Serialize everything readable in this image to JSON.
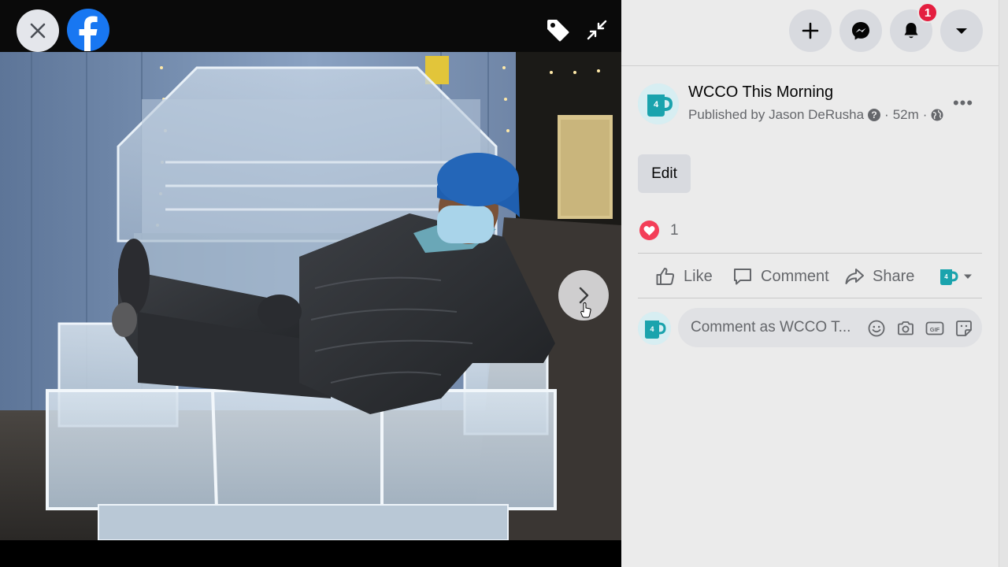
{
  "viewer": {
    "icons": {
      "close": "close-icon",
      "logo": "facebook-logo",
      "tag": "tag-icon",
      "collapse": "collapse-icon",
      "next": "chevron-right-icon"
    }
  },
  "header": {
    "notification_count": "1",
    "icons": [
      "plus-icon",
      "messenger-icon",
      "bell-icon",
      "caret-down-icon"
    ]
  },
  "post": {
    "page_name": "WCCO This Morning",
    "published_by": "Published by Jason DeRusha",
    "time": "52m",
    "separator": "·",
    "more": "•••",
    "edit_label": "Edit",
    "reaction_count": "1"
  },
  "actions": {
    "like": "Like",
    "comment": "Comment",
    "share": "Share"
  },
  "comment_box": {
    "placeholder": "Comment as WCCO T..."
  },
  "colors": {
    "facebook_blue": "#1877f2",
    "badge_red": "#e41e3f",
    "panel_bg": "#ebebeb",
    "text_secondary": "#65676b",
    "love_red": "#f33e58",
    "mug_teal": "#1aa3ad"
  }
}
